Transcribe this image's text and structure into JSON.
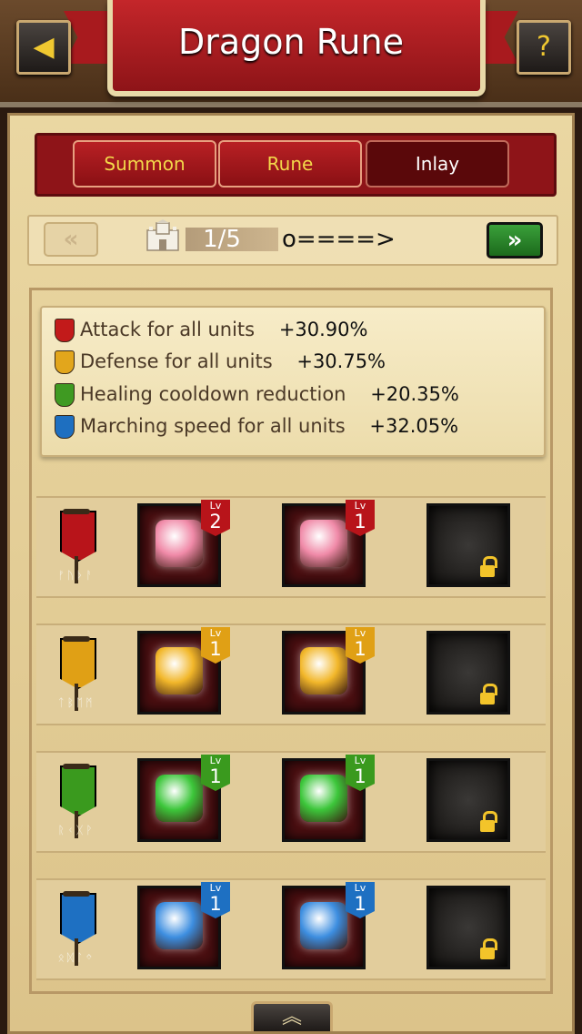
{
  "header": {
    "title": "Dragon Rune",
    "back_icon": "◀",
    "help_icon": "?"
  },
  "tabs": [
    {
      "label": "Summon",
      "active": false
    },
    {
      "label": "Rune",
      "active": false
    },
    {
      "label": "Inlay",
      "active": true
    }
  ],
  "pager": {
    "prev_icon": "«",
    "next_icon": "»",
    "page": "1/5",
    "arrow_text": "o====>"
  },
  "stats": [
    {
      "label": "Attack for all units",
      "value": "+30.90%",
      "color": "#c21a1a"
    },
    {
      "label": "Defense for all units",
      "value": "+30.75%",
      "color": "#e2a61c"
    },
    {
      "label": "Healing cooldown reduction",
      "value": "+20.35%",
      "color": "#3f9a22"
    },
    {
      "label": "Marching speed for all units",
      "value": "+32.05%",
      "color": "#1e6fc0"
    }
  ],
  "rune_rows": [
    {
      "name": "attack",
      "color": "#b8141a",
      "runes": "ᚠᚢᚦᚨ",
      "slots": [
        {
          "lv_label": "Lv",
          "level": "2"
        },
        {
          "lv_label": "Lv",
          "level": "1"
        }
      ],
      "gem_color": "#f08aa8"
    },
    {
      "name": "defense",
      "color": "#e0a015",
      "runes": "ᛏᛒᛖᛗ",
      "slots": [
        {
          "lv_label": "Lv",
          "level": "1"
        },
        {
          "lv_label": "Lv",
          "level": "1"
        }
      ],
      "gem_color": "#f2b72a"
    },
    {
      "name": "healing",
      "color": "#3a9a1e",
      "runes": "ᚱᚲᚷᚹ",
      "slots": [
        {
          "lv_label": "Lv",
          "level": "1"
        },
        {
          "lv_label": "Lv",
          "level": "1"
        }
      ],
      "gem_color": "#3cc63a"
    },
    {
      "name": "marching",
      "color": "#1e70c2",
      "runes": "ᛟᛞᛚᛜ",
      "slots": [
        {
          "lv_label": "Lv",
          "level": "1"
        },
        {
          "lv_label": "Lv",
          "level": "1"
        }
      ],
      "gem_color": "#3d8ee0"
    }
  ],
  "bottom": {
    "icon": "︽"
  }
}
